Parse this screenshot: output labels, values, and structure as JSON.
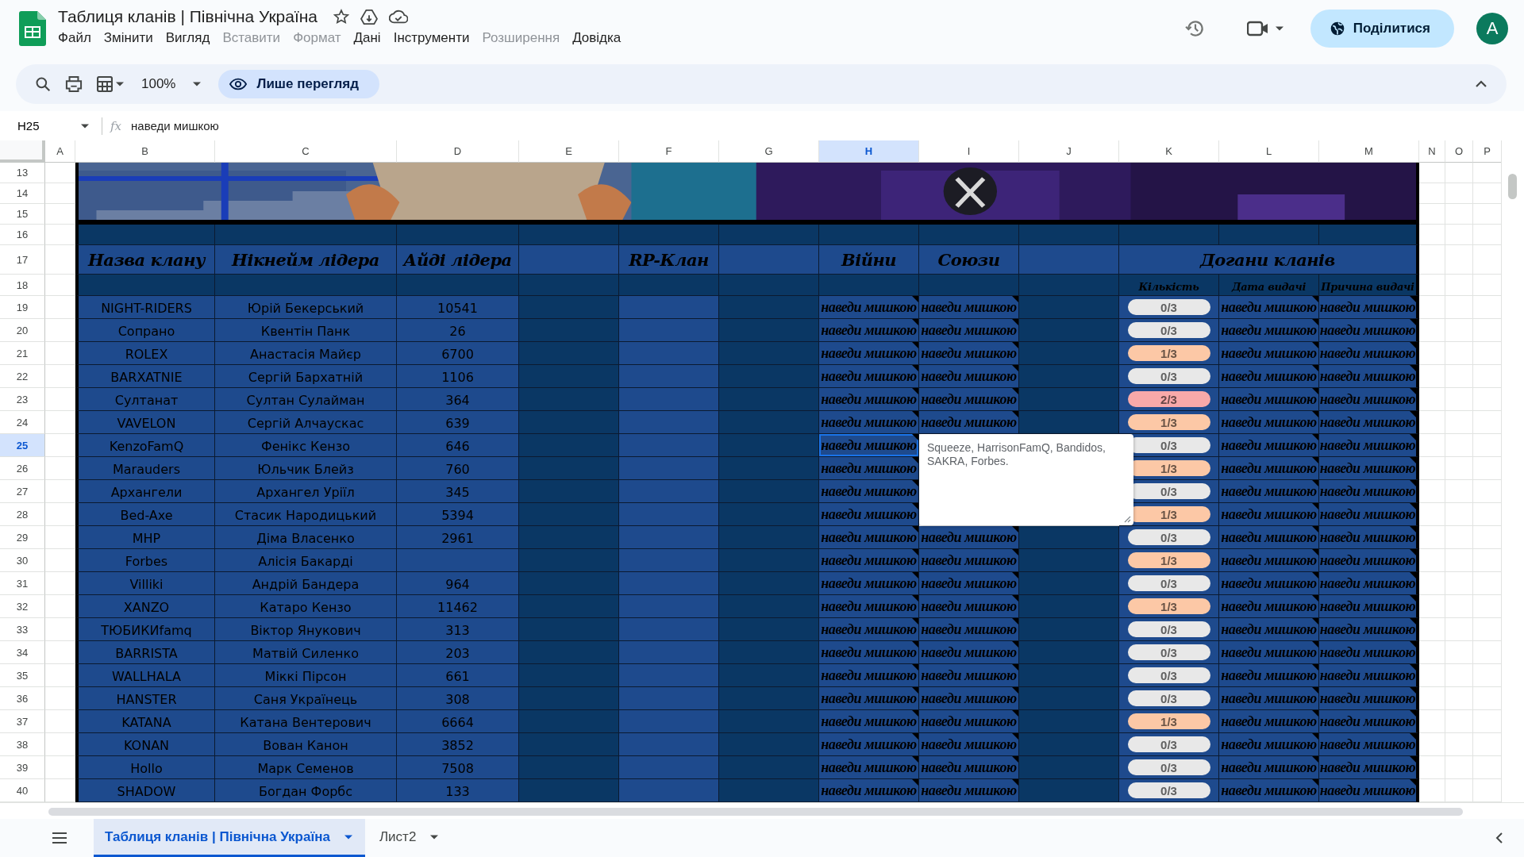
{
  "window": {
    "title": "Таблиця кланів | Північна Україна",
    "menu": [
      {
        "label": "Файл",
        "disabled": false
      },
      {
        "label": "Змінити",
        "disabled": false
      },
      {
        "label": "Вигляд",
        "disabled": false
      },
      {
        "label": "Вставити",
        "disabled": true
      },
      {
        "label": "Формат",
        "disabled": true
      },
      {
        "label": "Дані",
        "disabled": false
      },
      {
        "label": "Інструменти",
        "disabled": false
      },
      {
        "label": "Розширення",
        "disabled": true
      },
      {
        "label": "Довідка",
        "disabled": false
      }
    ],
    "share_button": "Поділитися",
    "avatar": "A"
  },
  "toolbar": {
    "zoom": "100%",
    "mode": "Лише перегляд"
  },
  "formula_bar": {
    "cell": "H25",
    "label": "fx",
    "value": "наведи мишкою"
  },
  "columns": [
    {
      "label": "A",
      "selected": false
    },
    {
      "label": "B",
      "selected": false
    },
    {
      "label": "C",
      "selected": false
    },
    {
      "label": "D",
      "selected": false
    },
    {
      "label": "E",
      "selected": false
    },
    {
      "label": "F",
      "selected": false
    },
    {
      "label": "G",
      "selected": false
    },
    {
      "label": "H",
      "selected": true
    },
    {
      "label": "I",
      "selected": false
    },
    {
      "label": "J",
      "selected": false
    },
    {
      "label": "K",
      "selected": false
    },
    {
      "label": "L",
      "selected": false
    },
    {
      "label": "M",
      "selected": false
    },
    {
      "label": "N",
      "selected": false
    },
    {
      "label": "O",
      "selected": false
    },
    {
      "label": "P",
      "selected": false
    }
  ],
  "rows": [
    {
      "label": "13",
      "selected": false
    },
    {
      "label": "14",
      "selected": false
    },
    {
      "label": "15",
      "selected": false
    },
    {
      "label": "16",
      "selected": false
    },
    {
      "label": "17",
      "selected": false
    },
    {
      "label": "18",
      "selected": false
    },
    {
      "label": "19",
      "selected": false
    },
    {
      "label": "20",
      "selected": false
    },
    {
      "label": "21",
      "selected": false
    },
    {
      "label": "22",
      "selected": false
    },
    {
      "label": "23",
      "selected": false
    },
    {
      "label": "24",
      "selected": false
    },
    {
      "label": "25",
      "selected": true
    },
    {
      "label": "26",
      "selected": false
    },
    {
      "label": "27",
      "selected": false
    },
    {
      "label": "28",
      "selected": false
    },
    {
      "label": "29",
      "selected": false
    },
    {
      "label": "30",
      "selected": false
    },
    {
      "label": "31",
      "selected": false
    },
    {
      "label": "32",
      "selected": false
    },
    {
      "label": "33",
      "selected": false
    },
    {
      "label": "34",
      "selected": false
    },
    {
      "label": "35",
      "selected": false
    },
    {
      "label": "36",
      "selected": false
    },
    {
      "label": "37",
      "selected": false
    },
    {
      "label": "38",
      "selected": false
    },
    {
      "label": "39",
      "selected": false
    },
    {
      "label": "40",
      "selected": false
    }
  ],
  "table": {
    "headers": {
      "clan_name": "Назва клану",
      "leader_nickname": "Нікнейм лідера",
      "leader_id": "Айді лідера",
      "rp_clan": "RP-Клан",
      "wars": "Війни",
      "alliances": "Союзи",
      "warnings": "Догани кланів"
    },
    "warnings_subheaders": {
      "count": "Кількість",
      "date": "Дата видачі",
      "reason": "Причина видачі"
    },
    "clans": [
      {
        "name": "NIGHT-RIDERS",
        "leader": "Юрій Бекерський",
        "id": "10541",
        "wars": "наведи мишкою",
        "alliances": "наведи мишкою",
        "warnings": "0/3",
        "color": "#e8e8e8",
        "date": "наведи мишкою",
        "reason": "наведи мишкою"
      },
      {
        "name": "Сопрано",
        "leader": "Квентін Панк",
        "id": "26",
        "wars": "наведи мишкою",
        "alliances": "наведи мишкою",
        "warnings": "0/3",
        "color": "#e8e8e8",
        "date": "наведи мишкою",
        "reason": "наведи мишкою"
      },
      {
        "name": "ROLEX",
        "leader": "Анастасія Майєр",
        "id": "6700",
        "wars": "наведи мишкою",
        "alliances": "наведи мишкою",
        "warnings": "1/3",
        "color": "#fcc8a6",
        "date": "наведи мишкою",
        "reason": "наведи мишкою"
      },
      {
        "name": "BARXATNIE",
        "leader": "Сергій Бархатній",
        "id": "1106",
        "wars": "наведи мишкою",
        "alliances": "наведи мишкою",
        "warnings": "0/3",
        "color": "#e8e8e8",
        "date": "наведи мишкою",
        "reason": "наведи мишкою"
      },
      {
        "name": "Султанат",
        "leader": "Султан Сулайман",
        "id": "364",
        "wars": "наведи мишкою",
        "alliances": "наведи мишкою",
        "warnings": "2/3",
        "color": "#f8a9a9",
        "date": "наведи мишкою",
        "reason": "наведи мишкою"
      },
      {
        "name": "VAVELON",
        "leader": "Сергій Алчаускас",
        "id": "639",
        "wars": "наведи мишкою",
        "alliances": "наведи мишкою",
        "warnings": "1/3",
        "color": "#fcc8a6",
        "date": "наведи мишкою",
        "reason": "наведи мишкою"
      },
      {
        "name": "KenzoFamQ",
        "leader": "Фенікс Кензо",
        "id": "646",
        "wars": "наведи мишкою",
        "warnings": "0/3",
        "color": "#e8e8e8",
        "date": "наведи мишкою",
        "reason": "наведи мишкою"
      },
      {
        "name": "Marauders",
        "leader": "Юльчик Блейз",
        "id": "760",
        "wars": "наведи мишкою",
        "warnings": "1/3",
        "color": "#fcc8a6",
        "date": "наведи мишкою",
        "reason": "наведи мишкою"
      },
      {
        "name": "Архангели",
        "leader": "Архангел Уріїл",
        "id": "345",
        "wars": "наведи мишкою",
        "warnings": "0/3",
        "color": "#e8e8e8",
        "date": "наведи мишкою",
        "reason": "наведи мишкою"
      },
      {
        "name": "Bed-Axe",
        "leader": "Стасик Народицький",
        "id": "5394",
        "wars": "наведи мишкою",
        "warnings": "1/3",
        "color": "#fcc8a6",
        "date": "наведи мишкою",
        "reason": "наведи мишкою"
      },
      {
        "name": "MHP",
        "leader": "Діма Власенко",
        "id": "2961",
        "wars": "наведи мишкою",
        "alliances": "наведи мишкою",
        "warnings": "0/3",
        "color": "#e8e8e8",
        "date": "наведи мишкою",
        "reason": "наведи мишкою"
      },
      {
        "name": "Forbes",
        "leader": "Алісія Бакарді",
        "wars": "наведи мишкою",
        "alliances": "наведи мишкою",
        "warnings": "1/3",
        "color": "#fcc8a6",
        "date": "наведи мишкою",
        "reason": "наведи мишкою"
      },
      {
        "name": "Villiki",
        "leader": "Андрій Бандера",
        "id": "964",
        "wars": "наведи мишкою",
        "alliances": "наведи мишкою",
        "warnings": "0/3",
        "color": "#e8e8e8",
        "date": "наведи мишкою",
        "reason": "наведи мишкою"
      },
      {
        "name": "XANZO",
        "leader": "Катаро Кензо",
        "id": "11462",
        "wars": "наведи мишкою",
        "alliances": "наведи мишкою",
        "warnings": "1/3",
        "color": "#fcc8a6",
        "date": "наведи мишкою",
        "reason": "наведи мишкою"
      },
      {
        "name": "ТЮБИКИfamq",
        "leader": "Віктор Янукович",
        "id": "313",
        "wars": "наведи мишкою",
        "alliances": "наведи мишкою",
        "warnings": "0/3",
        "color": "#e8e8e8",
        "date": "наведи мишкою",
        "reason": "наведи мишкою"
      },
      {
        "name": "BARRISTA",
        "leader": "Матвій Силенко",
        "id": "203",
        "wars": "наведи мишкою",
        "alliances": "наведи мишкою",
        "warnings": "0/3",
        "color": "#e8e8e8",
        "date": "наведи мишкою",
        "reason": "наведи мишкою"
      },
      {
        "name": "WALLHALA",
        "leader": "Міккі Пірсон",
        "id": "661",
        "wars": "наведи мишкою",
        "alliances": "наведи мишкою",
        "warnings": "0/3",
        "color": "#e8e8e8",
        "date": "наведи мишкою",
        "reason": "наведи мишкою"
      },
      {
        "name": "HANSTER",
        "leader": "Саня Українець",
        "id": "308",
        "wars": "наведи мишкою",
        "alliances": "наведи мишкою",
        "warnings": "0/3",
        "color": "#e8e8e8",
        "date": "наведи мишкою",
        "reason": "наведи мишкою"
      },
      {
        "name": "KATANA",
        "leader": "Катана Вентерович",
        "id": "6664",
        "wars": "наведи мишкою",
        "alliances": "наведи мишкою",
        "warnings": "1/3",
        "color": "#fcc8a6",
        "date": "наведи мишкою",
        "reason": "наведи мишкою"
      },
      {
        "name": "KONAN",
        "leader": "Вован Канон",
        "id": "3852",
        "wars": "наведи мишкою",
        "alliances": "наведи мишкою",
        "warnings": "0/3",
        "color": "#e8e8e8",
        "date": "наведи мишкою",
        "reason": "наведи мишкою"
      },
      {
        "name": "Hollo",
        "leader": "Марк Семенов",
        "id": "7508",
        "wars": "наведи мишкою",
        "alliances": "наведи мишкою",
        "warnings": "0/3",
        "color": "#e8e8e8",
        "date": "наведи мишкою",
        "reason": "наведи мишкою"
      },
      {
        "name": "SHADOW",
        "leader": "Богдан Форбс",
        "id": "133",
        "wars": "наведи мишкою",
        "alliances": "наведи мишкою",
        "warnings": "0/3",
        "color": "#e8e8e8",
        "date": "наведи мишкою",
        "reason": "наведи мишкою"
      }
    ]
  },
  "note": {
    "text": "Squeeze, HarrisonFamQ, Bandidos, SAKRA, Forbes."
  },
  "sheet_tabs": [
    {
      "label": "Таблиця кланів | Північна Україна",
      "selected": true
    },
    {
      "label": "Лист2",
      "selected": false
    }
  ]
}
